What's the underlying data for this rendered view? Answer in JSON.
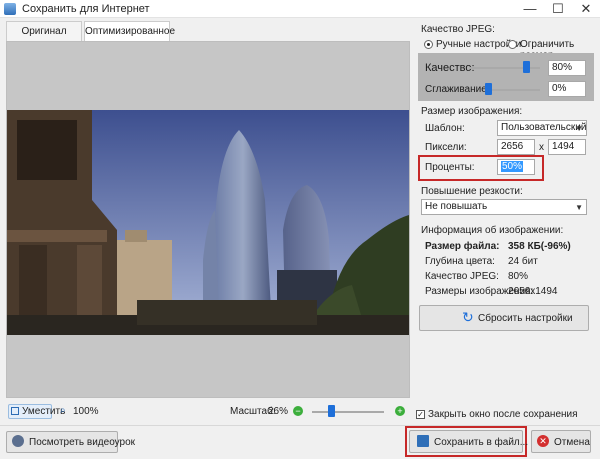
{
  "window": {
    "title": "Сохранить для Интернет",
    "minimize": "—",
    "maximize": "☐",
    "close": "✕"
  },
  "tabs": [
    {
      "label": "Оригинал"
    },
    {
      "label": "Оптимизированное"
    }
  ],
  "preview": {
    "fit_label": "Уместить",
    "actual_size_label": "100%",
    "zoom_label": "Масштаб:",
    "zoom_value": "26%",
    "zoom_level": 0.26
  },
  "jpeg_quality": {
    "group_title": "Качество JPEG:",
    "radio_manual": "Ручные настройки",
    "radio_limit": "Ограничить размер",
    "quality_label": "Качество:",
    "quality_value": "80%",
    "smoothing_label": "Сглаживание:",
    "smoothing_value": "0%"
  },
  "image_size": {
    "group_title": "Размер изображения:",
    "template_label": "Шаблон:",
    "template_value": "Пользовательский",
    "pixels_label": "Пиксели:",
    "width_value": "2656",
    "times": "x",
    "height_value": "1494",
    "percent_label": "Проценты:",
    "percent_value": "50%"
  },
  "sharpen": {
    "group_title": "Повышение резкости:",
    "value": "Не повышать"
  },
  "info": {
    "group_title": "Информация об изображении:",
    "file_size_label": "Размер файла:",
    "file_size_value": "358 КБ(-96%)",
    "color_depth_label": "Глубина цвета:",
    "color_depth_value": "24 бит",
    "jpeg_quality_label": "Качество JPEG:",
    "jpeg_quality_value": "80%",
    "dimensions_label": "Размеры изображения:",
    "dimensions_value": "2656x1494"
  },
  "reset_button": "Сбросить настройки",
  "close_after_save": "Закрыть окно после сохранения",
  "footer": {
    "video_button": "Посмотреть видеоурок",
    "save_button": "Сохранить в файл...",
    "cancel_button": "Отмена"
  },
  "colors": {
    "accent": "#1e6fd9",
    "highlight": "#c62828",
    "selection": "#3399ff"
  }
}
